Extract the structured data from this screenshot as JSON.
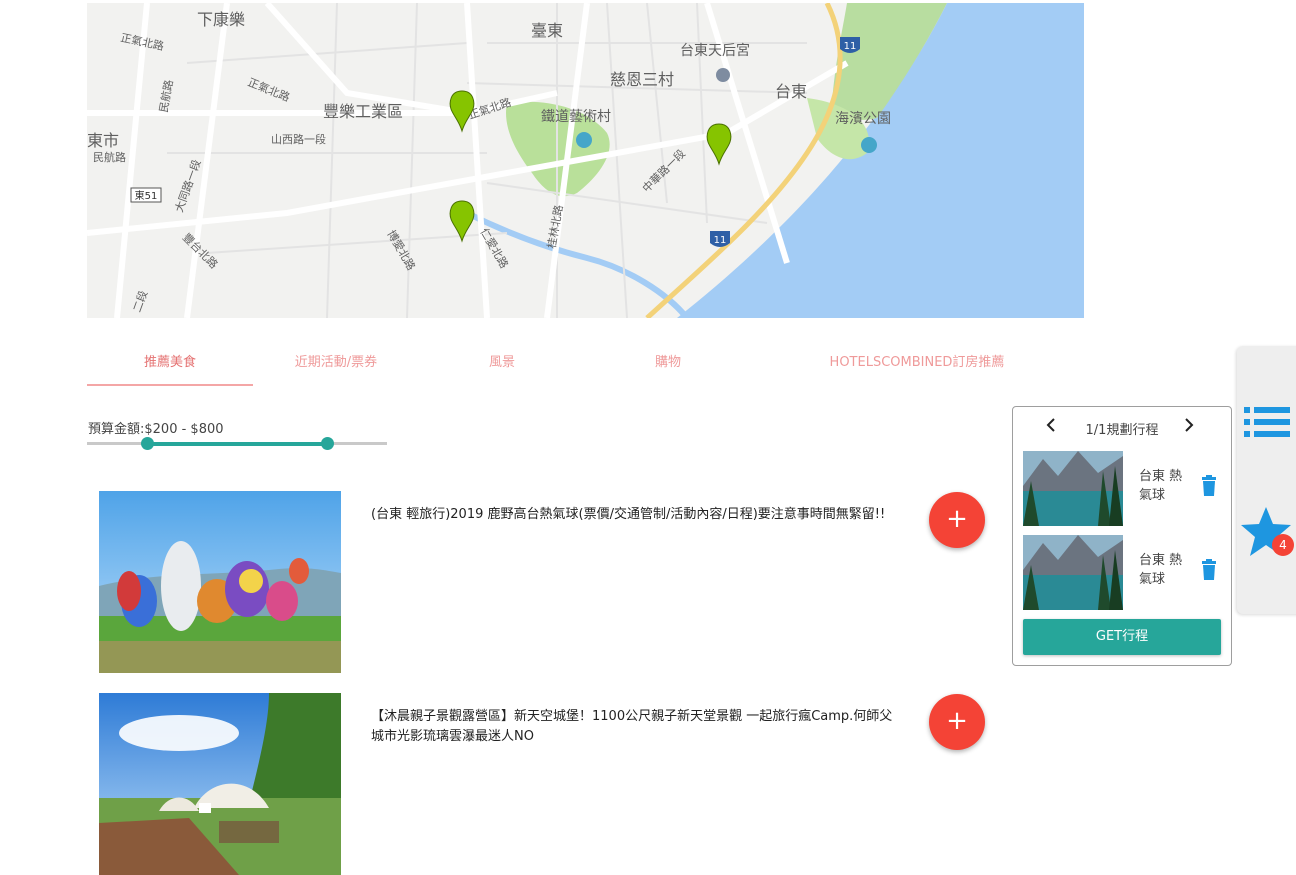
{
  "map": {
    "labels": {
      "xiakangle": "下康樂",
      "zhengqi_bei_1": "正氣北路",
      "zhengqi_bei_2": "正氣北路",
      "zhengqi_bei_3": "正氣北路",
      "minhang_1": "民航路",
      "minhang_2": "民航路",
      "fengle": "豐樂工業區",
      "shanxi": "山西路一段",
      "dongshi": "東市",
      "taidong_station": "臺東",
      "tianhou": "台東天后宮",
      "cien": "慈恩三村",
      "taidong": "台東",
      "railway_art": "鐵道藝術村",
      "haibin": "海濱公園",
      "zhonghua": "中華路一段",
      "taiwan9": "大同路一段",
      "hwy11a": "11",
      "hwy11b": "11",
      "dong51": "東51",
      "renai": "仁愛北路",
      "guilin": "桂林北路",
      "boai": "博愛北路",
      "fengtai": "豐台北路",
      "zhonghua2": "二段"
    }
  },
  "tabs": [
    {
      "label": "推薦美食",
      "active": true
    },
    {
      "label": "近期活動/票券",
      "active": false
    },
    {
      "label": "風景",
      "active": false
    },
    {
      "label": "購物",
      "active": false
    },
    {
      "label": "HOTELSCOMBINED訂房推薦",
      "active": false
    }
  ],
  "budget": {
    "label": "預算金額:$200 - $800",
    "min": 200,
    "max": 800,
    "range_fraction": [
      0.2,
      0.8
    ]
  },
  "cards": [
    {
      "title": "(台東 輕旅行)2019 鹿野高台熱氣球(票價/交通管制/活動內容/日程)要注意事時間無緊留!!",
      "add_label": "+"
    },
    {
      "title": "【沐晨親子景觀露營區】新天空城堡！1100公尺親子新天堂景觀 一起旅行瘋Camp.何師父 城市光影琉璃雲瀑最迷人NO",
      "add_label": "+"
    }
  ],
  "itinerary": {
    "pager": "1/1規劃行程",
    "prev_icon": "‹",
    "next_icon": "›",
    "items": [
      {
        "name": "台東 熱氣球"
      },
      {
        "name": "台東 熱氣球"
      }
    ],
    "get_label": "GET行程"
  },
  "side": {
    "badge_count": "4",
    "accent": "#1e96e0"
  }
}
